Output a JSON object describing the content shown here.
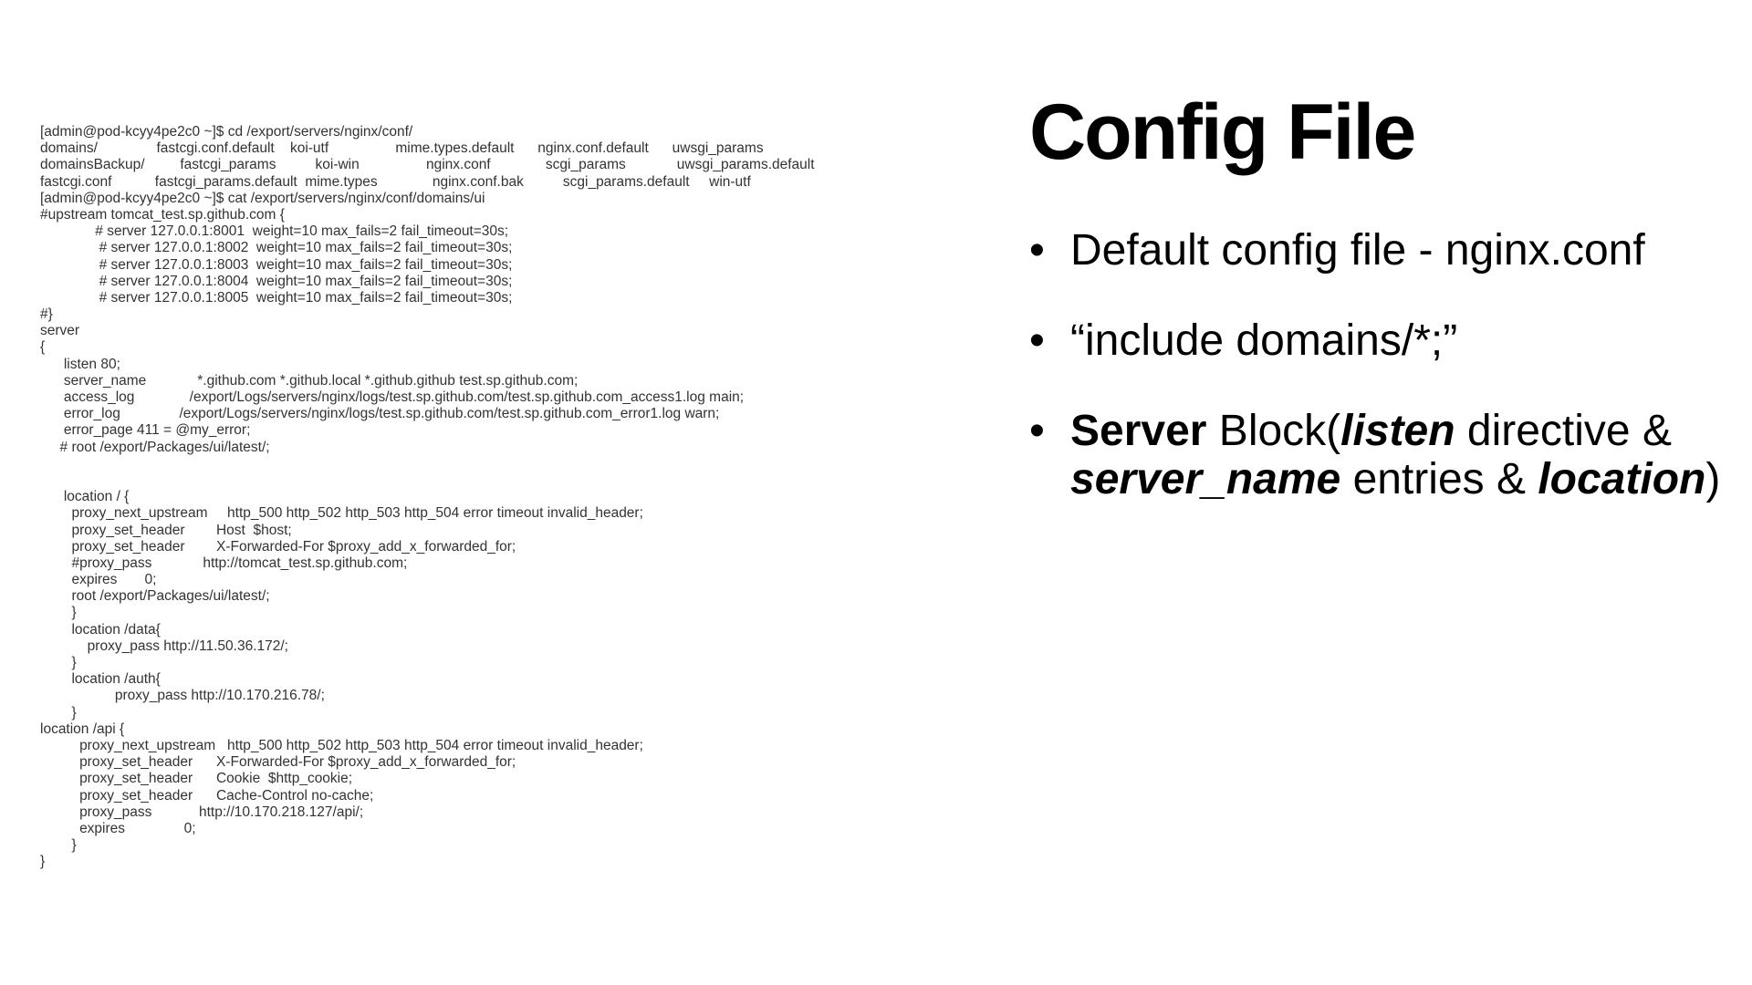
{
  "terminal": {
    "lines": [
      "[admin@pod-kcyy4pe2c0 ~]$ cd /export/servers/nginx/conf/",
      "domains/               fastcgi.conf.default    koi-utf                 mime.types.default      nginx.conf.default      uwsgi_params",
      "domainsBackup/         fastcgi_params          koi-win                 nginx.conf              scgi_params             uwsgi_params.default",
      "fastcgi.conf           fastcgi_params.default  mime.types              nginx.conf.bak          scgi_params.default     win-utf",
      "[admin@pod-kcyy4pe2c0 ~]$ cat /export/servers/nginx/conf/domains/ui",
      "#upstream tomcat_test.sp.github.com {",
      "              # server 127.0.0.1:8001  weight=10 max_fails=2 fail_timeout=30s;",
      "               # server 127.0.0.1:8002  weight=10 max_fails=2 fail_timeout=30s;",
      "               # server 127.0.0.1:8003  weight=10 max_fails=2 fail_timeout=30s;",
      "               # server 127.0.0.1:8004  weight=10 max_fails=2 fail_timeout=30s;",
      "               # server 127.0.0.1:8005  weight=10 max_fails=2 fail_timeout=30s;",
      "#}",
      "server",
      "{",
      "      listen 80;",
      "      server_name             *.github.com *.github.local *.github.github test.sp.github.com;",
      "      access_log              /export/Logs/servers/nginx/logs/test.sp.github.com/test.sp.github.com_access1.log main;",
      "      error_log               /export/Logs/servers/nginx/logs/test.sp.github.com/test.sp.github.com_error1.log warn;",
      "      error_page 411 = @my_error;",
      "     # root /export/Packages/ui/latest/;",
      "",
      "",
      "      location / {",
      "        proxy_next_upstream     http_500 http_502 http_503 http_504 error timeout invalid_header;",
      "        proxy_set_header        Host  $host;",
      "        proxy_set_header        X-Forwarded-For $proxy_add_x_forwarded_for;",
      "        #proxy_pass             http://tomcat_test.sp.github.com;",
      "        expires       0;",
      "        root /export/Packages/ui/latest/;",
      "        }",
      "        location /data{",
      "            proxy_pass http://11.50.36.172/;",
      "        }",
      "        location /auth{",
      "                   proxy_pass http://10.170.216.78/;",
      "        }",
      "location /api {",
      "          proxy_next_upstream   http_500 http_502 http_503 http_504 error timeout invalid_header;",
      "          proxy_set_header      X-Forwarded-For $proxy_add_x_forwarded_for;",
      "          proxy_set_header      Cookie  $http_cookie;",
      "          proxy_set_header      Cache-Control no-cache;",
      "          proxy_pass            http://10.170.218.127/api/;",
      "          expires               0;",
      "        }",
      "}"
    ]
  },
  "slide": {
    "title": "Config File",
    "bullet_symbol": "•",
    "bullets": [
      {
        "segments": [
          {
            "text": "Default config file - nginx.conf",
            "style": "normal"
          }
        ]
      },
      {
        "segments": [
          {
            "text": "“include domains/*;”",
            "style": "normal"
          }
        ]
      },
      {
        "segments": [
          {
            "text": "Server",
            "style": "bold"
          },
          {
            "text": " Block(",
            "style": "normal"
          },
          {
            "text": "listen",
            "style": "bold-italic"
          },
          {
            "text": " directive & ",
            "style": "normal"
          },
          {
            "text": "server_name",
            "style": "bold-italic"
          },
          {
            "text": " entries & ",
            "style": "normal"
          },
          {
            "text": "location",
            "style": "bold-italic"
          },
          {
            "text": ")",
            "style": "normal"
          }
        ]
      }
    ]
  }
}
